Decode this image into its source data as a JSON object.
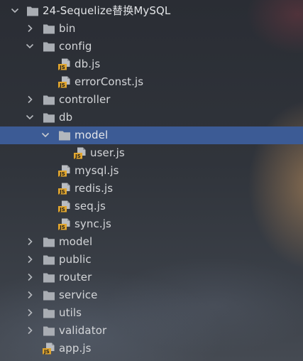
{
  "project_tree": {
    "root": {
      "label": "24-Sequelize替换MySQL",
      "icon": "folder-icon",
      "expanded": true
    },
    "items": [
      {
        "label": "bin",
        "type": "folder",
        "expanded": false
      },
      {
        "label": "config",
        "type": "folder",
        "expanded": true
      },
      {
        "label": "db.js",
        "type": "js-file"
      },
      {
        "label": "errorConst.js",
        "type": "js-file"
      },
      {
        "label": "controller",
        "type": "folder",
        "expanded": false
      },
      {
        "label": "db",
        "type": "folder",
        "expanded": true
      },
      {
        "label": "model",
        "type": "folder",
        "expanded": true,
        "selected": true
      },
      {
        "label": "user.js",
        "type": "js-file"
      },
      {
        "label": "mysql.js",
        "type": "js-file"
      },
      {
        "label": "redis.js",
        "type": "js-file"
      },
      {
        "label": "seq.js",
        "type": "js-file"
      },
      {
        "label": "sync.js",
        "type": "js-file"
      },
      {
        "label": "model",
        "type": "folder",
        "expanded": false
      },
      {
        "label": "public",
        "type": "folder",
        "expanded": false
      },
      {
        "label": "router",
        "type": "folder",
        "expanded": false
      },
      {
        "label": "service",
        "type": "folder",
        "expanded": false
      },
      {
        "label": "utils",
        "type": "folder",
        "expanded": false
      },
      {
        "label": "validator",
        "type": "folder",
        "expanded": false
      },
      {
        "label": "app.js",
        "type": "js-file"
      }
    ]
  },
  "icons": {
    "folder": "folder-icon",
    "js_file": "js-file-icon",
    "chevron_right": "chevron-right-icon",
    "chevron_down": "chevron-down-icon",
    "js_badge_text": "JS"
  },
  "colors": {
    "selection": "#3c5b95",
    "text": "#d4d6d9",
    "folder": "#a9adb3",
    "js_badge": "#e0a52e",
    "chevron": "#b6b9be"
  }
}
